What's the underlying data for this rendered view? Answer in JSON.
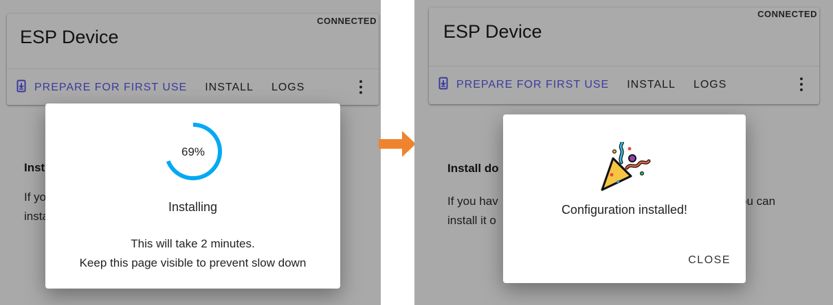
{
  "left": {
    "card": {
      "title": "ESP Device",
      "status": "CONNECTED",
      "actions": {
        "prepare": "PREPARE FOR FIRST USE",
        "install": "INSTALL",
        "logs": "LOGS"
      }
    },
    "page": {
      "heading": "Inst",
      "para_line1": "If yo",
      "para_line2": "insta"
    },
    "dialog": {
      "progress_percent": 69,
      "progress_label": "69%",
      "status": "Installing",
      "note_line1": "This will take 2 minutes.",
      "note_line2": "Keep this page visible to prevent slow down"
    }
  },
  "right": {
    "card": {
      "title": "ESP Device",
      "status": "CONNECTED",
      "actions": {
        "prepare": "PREPARE FOR FIRST USE",
        "install": "INSTALL",
        "logs": "LOGS"
      }
    },
    "page": {
      "heading": "Install do",
      "para_line1": "If you hav",
      "para_line1_end": "ou can",
      "para_line2": "install it o"
    },
    "dialog": {
      "message": "Configuration installed!",
      "close_label": "CLOSE"
    }
  },
  "colors": {
    "overlay": "#a9a9a9",
    "accent_progress": "#03a9f4",
    "primary_action": "#3b3b9e",
    "arrow": "#f0832d"
  }
}
